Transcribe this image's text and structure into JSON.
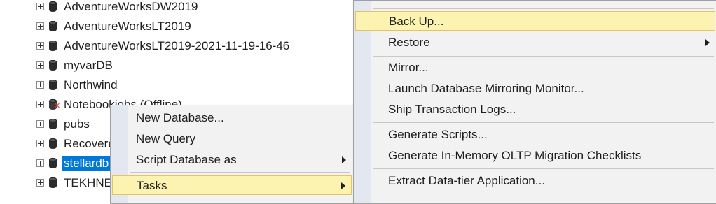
{
  "tree": {
    "items": [
      {
        "label": "AdventureWorksDW2019",
        "selected": false,
        "offline": false
      },
      {
        "label": "AdventureWorksLT2019",
        "selected": false,
        "offline": false
      },
      {
        "label": "AdventureWorksLT2019-2021-11-19-16-46",
        "selected": false,
        "offline": false
      },
      {
        "label": "myvarDB",
        "selected": false,
        "offline": false
      },
      {
        "label": "Northwind",
        "selected": false,
        "offline": false
      },
      {
        "label": "Notebookjobs (Offline)",
        "selected": false,
        "offline": true
      },
      {
        "label": "pubs",
        "selected": false,
        "offline": false
      },
      {
        "label": "Recovere",
        "selected": false,
        "offline": false
      },
      {
        "label": "stellardb",
        "selected": true,
        "offline": false
      },
      {
        "label": "TEKHNE",
        "selected": false,
        "offline": false
      }
    ]
  },
  "context_menu": {
    "items": [
      {
        "label": "New Database...",
        "submenu": false,
        "highlighted": false
      },
      {
        "label": "New Query",
        "submenu": false,
        "highlighted": false
      },
      {
        "label": "Script Database as",
        "submenu": true,
        "highlighted": false
      },
      {
        "label": "Tasks",
        "submenu": true,
        "highlighted": true
      }
    ]
  },
  "tasks_menu": {
    "items": [
      {
        "label": "Back Up...",
        "submenu": false,
        "highlighted": true
      },
      {
        "label": "Restore",
        "submenu": true,
        "highlighted": false
      },
      {
        "label": "Mirror...",
        "submenu": false,
        "highlighted": false
      },
      {
        "label": "Launch Database Mirroring Monitor...",
        "submenu": false,
        "highlighted": false
      },
      {
        "label": "Ship Transaction Logs...",
        "submenu": false,
        "highlighted": false
      },
      {
        "label": "Generate Scripts...",
        "submenu": false,
        "highlighted": false
      },
      {
        "label": "Generate In-Memory OLTP Migration Checklists",
        "submenu": false,
        "highlighted": false
      },
      {
        "label": "Extract Data-tier Application...",
        "submenu": false,
        "highlighted": false
      }
    ]
  },
  "colors": {
    "selection": "#0078d7",
    "menu_highlight": "#fcf3b0",
    "menu_background": "#f2f2f2",
    "offline_marker": "#d23b2e"
  },
  "icons": {
    "database": "database-icon",
    "expand": "expand-plus-icon",
    "offline": "offline-x-icon",
    "submenu": "submenu-arrow-icon"
  }
}
